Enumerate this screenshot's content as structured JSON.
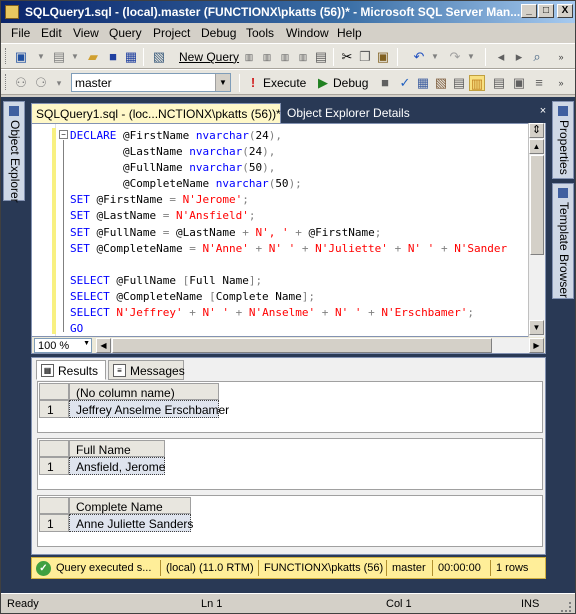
{
  "window": {
    "title": "SQLQuery1.sql - (local).master (FUNCTIONX\\pkatts (56))* - Microsoft SQL Server Man...",
    "minimize": "_",
    "maximize": "□",
    "close": "X"
  },
  "menu": [
    "File",
    "Edit",
    "View",
    "Query",
    "Project",
    "Debug",
    "Tools",
    "Window",
    "Help"
  ],
  "toolbar1": {
    "new_query": "New Query"
  },
  "toolbar2": {
    "database": "master",
    "execute": "Execute",
    "debug": "Debug"
  },
  "sidepanels": {
    "left": "Object Explorer",
    "right_top": "Properties",
    "right_bottom": "Template Browser"
  },
  "tabs": {
    "active": "SQLQuery1.sql - (loc...NCTIONX\\pkatts (56))*",
    "other": "Object Explorer Details",
    "close": "×"
  },
  "editor": {
    "collapse_symbol": "−",
    "zoom": "100 %",
    "code_lines": [
      [
        [
          "kw",
          "DECLARE "
        ],
        [
          "var",
          "@FirstName "
        ],
        [
          "kw",
          "nvarchar"
        ],
        [
          "gray",
          "("
        ],
        [
          "var",
          "24"
        ],
        [
          "gray",
          "),"
        ]
      ],
      [
        [
          "var",
          "        @LastName "
        ],
        [
          "kw",
          "nvarchar"
        ],
        [
          "gray",
          "("
        ],
        [
          "var",
          "24"
        ],
        [
          "gray",
          "),"
        ]
      ],
      [
        [
          "var",
          "        @FullName "
        ],
        [
          "kw",
          "nvarchar"
        ],
        [
          "gray",
          "("
        ],
        [
          "var",
          "50"
        ],
        [
          "gray",
          "),"
        ]
      ],
      [
        [
          "var",
          "        @CompleteName "
        ],
        [
          "kw",
          "nvarchar"
        ],
        [
          "gray",
          "("
        ],
        [
          "var",
          "50"
        ],
        [
          "gray",
          ");"
        ]
      ],
      [
        [
          "kw",
          "SET "
        ],
        [
          "var",
          "@FirstName "
        ],
        [
          "gray",
          "= "
        ],
        [
          "str",
          "N'Jerome'"
        ],
        [
          "gray",
          ";"
        ]
      ],
      [
        [
          "kw",
          "SET "
        ],
        [
          "var",
          "@LastName "
        ],
        [
          "gray",
          "= "
        ],
        [
          "str",
          "N'Ansfield'"
        ],
        [
          "gray",
          ";"
        ]
      ],
      [
        [
          "kw",
          "SET "
        ],
        [
          "var",
          "@FullName "
        ],
        [
          "gray",
          "= "
        ],
        [
          "var",
          "@LastName "
        ],
        [
          "gray",
          "+ "
        ],
        [
          "str",
          "N', ' "
        ],
        [
          "gray",
          "+ "
        ],
        [
          "var",
          "@FirstName"
        ],
        [
          "gray",
          ";"
        ]
      ],
      [
        [
          "kw",
          "SET "
        ],
        [
          "var",
          "@CompleteName "
        ],
        [
          "gray",
          "= "
        ],
        [
          "str",
          "N'Anne' "
        ],
        [
          "gray",
          "+ "
        ],
        [
          "str",
          "N' ' "
        ],
        [
          "gray",
          "+ "
        ],
        [
          "str",
          "N'Juliette' "
        ],
        [
          "gray",
          "+ "
        ],
        [
          "str",
          "N' ' "
        ],
        [
          "gray",
          "+ "
        ],
        [
          "str",
          "N'Sander"
        ]
      ],
      [],
      [
        [
          "kw",
          "SELECT "
        ],
        [
          "var",
          "@FullName "
        ],
        [
          "gray",
          "["
        ],
        [
          "var",
          "Full Name"
        ],
        [
          "gray",
          "];"
        ]
      ],
      [
        [
          "kw",
          "SELECT "
        ],
        [
          "var",
          "@CompleteName "
        ],
        [
          "gray",
          "["
        ],
        [
          "var",
          "Complete Name"
        ],
        [
          "gray",
          "];"
        ]
      ],
      [
        [
          "kw",
          "SELECT "
        ],
        [
          "str",
          "N'Jeffrey' "
        ],
        [
          "gray",
          "+ "
        ],
        [
          "str",
          "N' ' "
        ],
        [
          "gray",
          "+ "
        ],
        [
          "str",
          "N'Anselme' "
        ],
        [
          "gray",
          "+ "
        ],
        [
          "str",
          "N' ' "
        ],
        [
          "gray",
          "+ "
        ],
        [
          "str",
          "N'Erschbamer'"
        ],
        [
          "gray",
          ";"
        ]
      ],
      [
        [
          "kw",
          "GO"
        ]
      ]
    ]
  },
  "results": {
    "tab_results": "Results",
    "tab_messages": "Messages",
    "grids": [
      {
        "header": "(No column name)",
        "row": "1",
        "value": "Jeffrey Anselme Erschbamer"
      },
      {
        "header": "Full Name",
        "row": "1",
        "value": "Ansfield, Jerome"
      },
      {
        "header": "Complete Name",
        "row": "1",
        "value": "Anne Juliette Sanders"
      }
    ]
  },
  "query_status": {
    "ok": "✓",
    "message": "Query executed s...",
    "server": "(local) (11.0 RTM)",
    "user": "FUNCTIONX\\pkatts (56)",
    "database": "master",
    "time": "00:00:00",
    "rows": "1 rows"
  },
  "statusbar": {
    "ready": "Ready",
    "line": "Ln 1",
    "col": "Col 1",
    "mode": "INS"
  }
}
